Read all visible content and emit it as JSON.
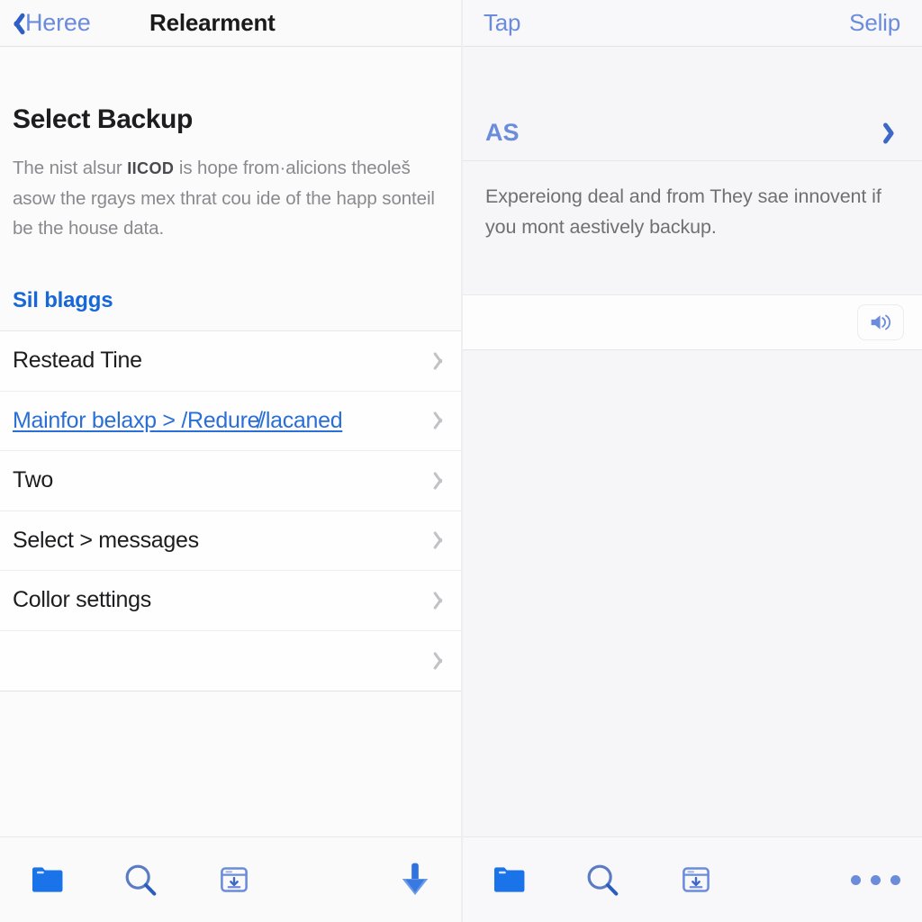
{
  "left": {
    "navbar": {
      "back_label": "Heree",
      "back_icon": "chevron-left-icon",
      "title": "Relearment"
    },
    "heading": "Select Backup",
    "description_part1": "The nist alsur ",
    "description_bold": "IICOD",
    "description_part2": " is hope from·alicions theoleš asow the rgays mex thrat cou ide of the happ sonteil be the house data.",
    "group_label": "Sil blaggs",
    "rows": [
      {
        "label": "Restead Tine",
        "style": "plain",
        "chevron": "chevron-right-icon"
      },
      {
        "label": "Mainfor belaxp > /Redure̸/lacaned",
        "style": "link",
        "chevron": "chevron-right-icon"
      },
      {
        "label": "Two",
        "style": "plain",
        "chevron": "chevron-right-icon"
      },
      {
        "label": "Select > messages",
        "style": "plain",
        "chevron": "chevron-right-icon"
      },
      {
        "label": "Collor settings",
        "style": "plain",
        "chevron": "chevron-right-icon"
      },
      {
        "label": "",
        "style": "plain",
        "chevron": "chevron-right-icon"
      }
    ],
    "toolbar": {
      "items": [
        {
          "icon": "folder-icon"
        },
        {
          "icon": "search-icon"
        },
        {
          "icon": "window-download-icon"
        },
        {
          "icon": "download-arrow-icon"
        }
      ]
    }
  },
  "right": {
    "navbar": {
      "left_link": "Tap",
      "right_link": "Selip"
    },
    "item": {
      "label": "AS",
      "chevron": "chevron-right-icon"
    },
    "description": "Expereiong deal and from They sae innovent if you mont aestively backup.",
    "input": {
      "value": "",
      "placeholder": "",
      "button_icon": "speaker-icon"
    },
    "toolbar": {
      "items": [
        {
          "icon": "folder-icon"
        },
        {
          "icon": "search-icon"
        },
        {
          "icon": "window-download-icon"
        },
        {
          "icon": "more-dots-icon"
        }
      ]
    }
  },
  "colors": {
    "accent_blue": "#1a73e8",
    "link_blue": "#6b8bdb",
    "text_dark": "#1d1d1f",
    "text_muted": "#8a8a8e",
    "chevron_grey": "#c2c2c6",
    "background": "#f6f6f8"
  }
}
